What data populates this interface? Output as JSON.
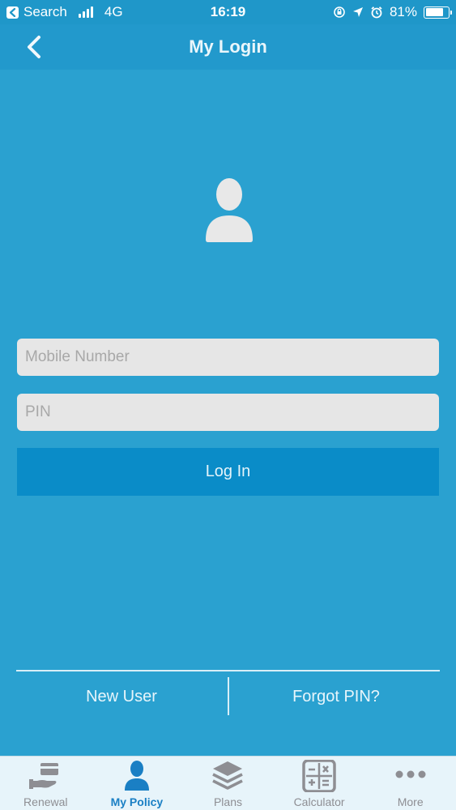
{
  "status_bar": {
    "back_app": "Search",
    "network": "4G",
    "time": "16:19",
    "battery": "81%",
    "battery_level": 0.81
  },
  "nav": {
    "title": "My Login"
  },
  "form": {
    "mobile_placeholder": "Mobile Number",
    "mobile_value": "",
    "pin_placeholder": "PIN",
    "pin_value": "",
    "login_label": "Log In"
  },
  "links": {
    "new_user": "New User",
    "forgot_pin": "Forgot PIN?"
  },
  "tabs": [
    {
      "label": "Renewal",
      "icon": "renewal-icon",
      "active": false
    },
    {
      "label": "My Policy",
      "icon": "person-icon",
      "active": true
    },
    {
      "label": "Plans",
      "icon": "layers-icon",
      "active": false
    },
    {
      "label": "Calculator",
      "icon": "calculator-icon",
      "active": false
    },
    {
      "label": "More",
      "icon": "more-icon",
      "active": false
    }
  ],
  "colors": {
    "background": "#2aa1d0",
    "nav_bar": "#2299cc",
    "login_button": "#0a8cc8",
    "field": "#e6e6e6",
    "tab_active": "#1a7fc4",
    "tab_inactive": "#8e8e93"
  }
}
